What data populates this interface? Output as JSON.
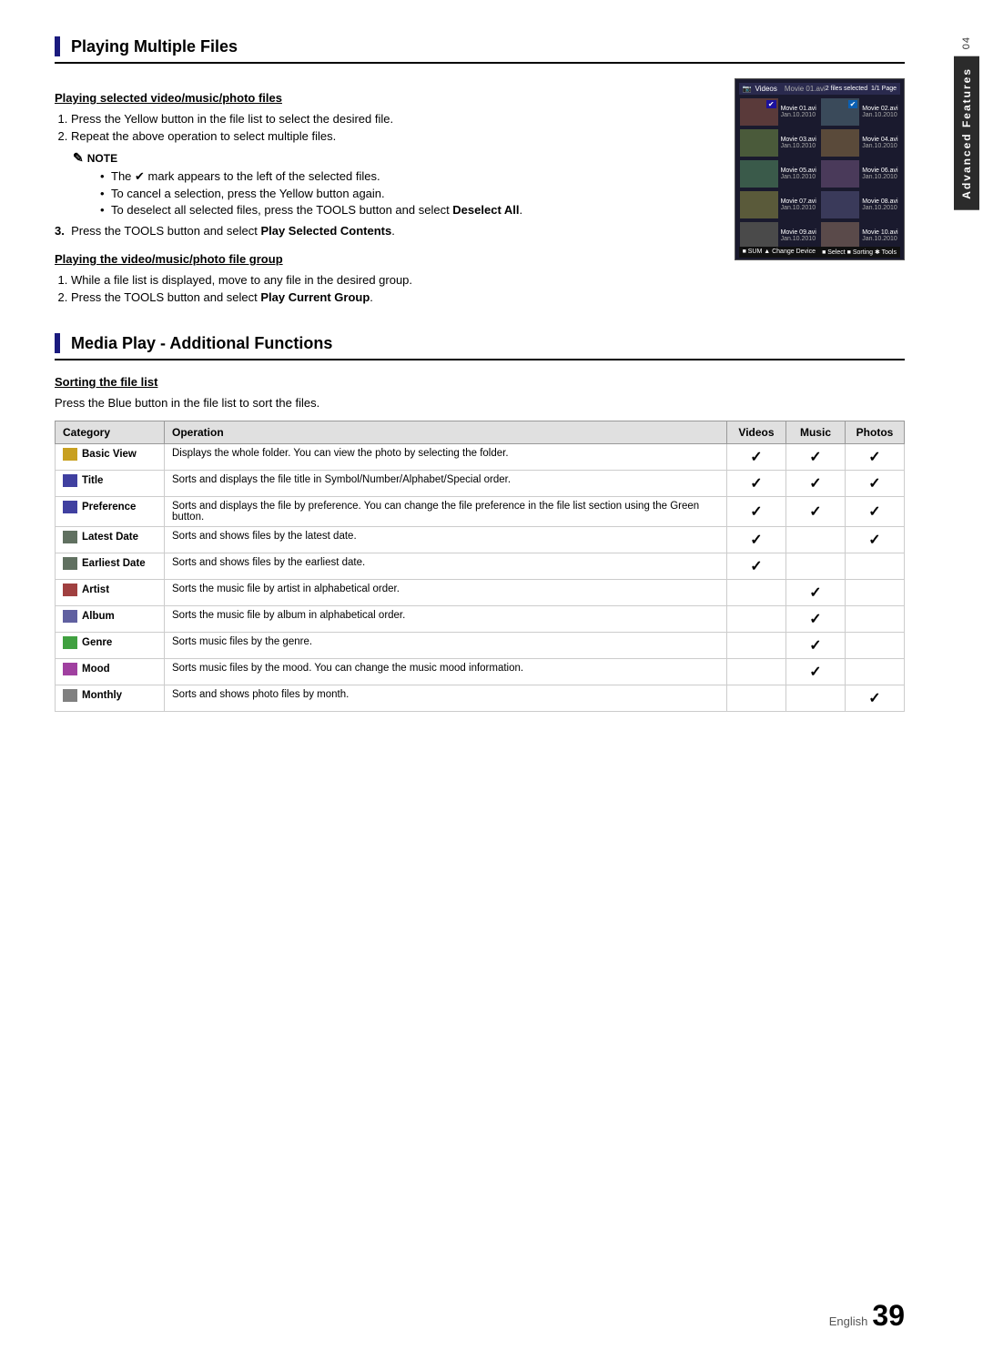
{
  "page": {
    "chapter": "04",
    "sidebar_label": "Advanced Features",
    "footer_english": "English",
    "footer_page": "39"
  },
  "section1": {
    "title": "Playing Multiple Files",
    "subsection1": {
      "title": "Playing selected video/music/photo files",
      "steps": [
        "Press the Yellow button in the file list to select the desired file.",
        "Repeat the above operation to select multiple files."
      ],
      "note_label": "NOTE",
      "note_bullets": [
        "The ✔ mark appears to the left of the selected files.",
        "To cancel a selection, press the Yellow button again.",
        "To deselect all selected files, press the TOOLS button and select Deselect All."
      ]
    },
    "step3": "Press the TOOLS button and select Play Selected Contents.",
    "subsection2": {
      "title": "Playing the video/music/photo file group",
      "steps": [
        "While a file list is displayed, move to any file in the desired group.",
        "Press the TOOLS button and select Play Current Group."
      ]
    }
  },
  "screenshot": {
    "header_icon": "📷",
    "header_label": "Videos",
    "header_file": "Movie 01.avi",
    "header_info": "2 files selected  1/1 Page",
    "items": [
      {
        "name": "Movie 01.avi",
        "date": "Jan.10.2010",
        "checked": true
      },
      {
        "name": "Movie 02.avi",
        "date": "Jan.10.2010",
        "checked": false
      },
      {
        "name": "Movie 03.avi",
        "date": "Jan.10.2010",
        "checked": false
      },
      {
        "name": "Movie 04.avi",
        "date": "Jan.10.2010",
        "checked": false
      },
      {
        "name": "Movie 05.avi",
        "date": "Jan.10.2010",
        "checked": false
      },
      {
        "name": "Movie 06.avi",
        "date": "Jan.10.2010",
        "checked": false
      },
      {
        "name": "Movie 07.avi",
        "date": "Jan.10.2010",
        "checked": false
      },
      {
        "name": "Movie 08.avi",
        "date": "Jan.10.2010",
        "checked": false
      },
      {
        "name": "Movie 09.avi",
        "date": "Jan.10.2010",
        "checked": false
      },
      {
        "name": "Movie 10.avi",
        "date": "Jan.10.2010",
        "checked": false
      }
    ],
    "footer": "■ SUM  ▲ Change Device       ■ Select  ■ Sorting  ✱ Tools"
  },
  "section2": {
    "title": "Media Play - Additional Functions",
    "subsection1": {
      "title": "Sorting the file list",
      "description": "Press the Blue button in the file list to sort the files."
    },
    "table": {
      "headers": [
        "Category",
        "Operation",
        "Videos",
        "Music",
        "Photos"
      ],
      "rows": [
        {
          "category": "Basic View",
          "icon_type": "folder",
          "operation": "Displays the whole folder. You can view the photo by selecting the folder.",
          "videos": true,
          "music": true,
          "photos": true
        },
        {
          "category": "Title",
          "icon_type": "title",
          "operation": "Sorts and displays the file title in Symbol/Number/Alphabet/Special order.",
          "videos": true,
          "music": true,
          "photos": true
        },
        {
          "category": "Preference",
          "icon_type": "pref",
          "operation": "Sorts and displays the file by preference. You can change the file preference in the file list section using the Green button.",
          "videos": true,
          "music": true,
          "photos": true
        },
        {
          "category": "Latest Date",
          "icon_type": "latest",
          "operation": "Sorts and shows files by the latest date.",
          "videos": true,
          "music": false,
          "photos": true
        },
        {
          "category": "Earliest Date",
          "icon_type": "earliest",
          "operation": "Sorts and shows files by the earliest date.",
          "videos": true,
          "music": false,
          "photos": false
        },
        {
          "category": "Artist",
          "icon_type": "artist",
          "operation": "Sorts the music file by artist in alphabetical order.",
          "videos": false,
          "music": true,
          "photos": false
        },
        {
          "category": "Album",
          "icon_type": "album",
          "operation": "Sorts the music file by album in alphabetical order.",
          "videos": false,
          "music": true,
          "photos": false
        },
        {
          "category": "Genre",
          "icon_type": "genre",
          "operation": "Sorts music files by the genre.",
          "videos": false,
          "music": true,
          "photos": false
        },
        {
          "category": "Mood",
          "icon_type": "mood",
          "operation": "Sorts music files by the mood. You can change the music mood information.",
          "videos": false,
          "music": true,
          "photos": false
        },
        {
          "category": "Monthly",
          "icon_type": "monthly",
          "operation": "Sorts and shows photo files by month.",
          "videos": false,
          "music": false,
          "photos": true
        }
      ]
    }
  }
}
